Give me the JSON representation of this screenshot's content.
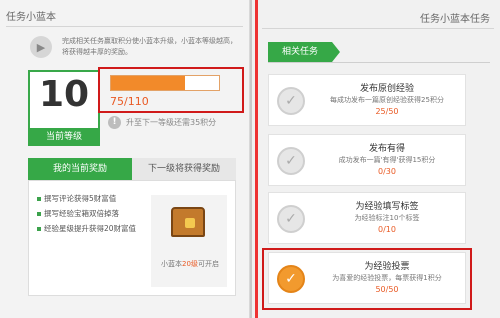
{
  "left": {
    "header": "任务小蓝本",
    "intro": "完成相关任务赢取积分使小蓝本升级，小蓝本等级越高，将获得越丰厚的奖励。",
    "level": {
      "value": "10",
      "label": "当前等级"
    },
    "progress": {
      "text": "75/110",
      "fraction": 0.682
    },
    "upgrade_hint": "升至下一等级还需35积分",
    "tabs": {
      "current": "我的当前奖励",
      "next": "下一级将获得奖励"
    },
    "rewards": [
      "撰写评论获得5财富值",
      "撰写经验宝箱双倍掉落",
      "经验星级提升获得20财富值"
    ],
    "chest_caption": {
      "prefix": "小蓝本",
      "highlight": "20级",
      "suffix": "可开启"
    }
  },
  "right": {
    "header": "任务小蓝本任务",
    "section_title": "相关任务",
    "tasks": [
      {
        "title": "发布原创经验",
        "desc": "每成功发布一篇原创经验获得25积分",
        "score": "25/50"
      },
      {
        "title": "发布有得",
        "desc": "成功发布一篇'有得'获得15积分",
        "score": "0/30"
      },
      {
        "title": "为经验填写标签",
        "desc": "为经验标注10个标签",
        "score": "0/10"
      },
      {
        "title": "为经验投票",
        "desc": "为喜爱的经验投票，每票获得1积分",
        "score": "50/50"
      }
    ]
  },
  "colors": {
    "accent": "#36a847",
    "progress": "#f28a2a",
    "highlight": "#d01a1a"
  }
}
